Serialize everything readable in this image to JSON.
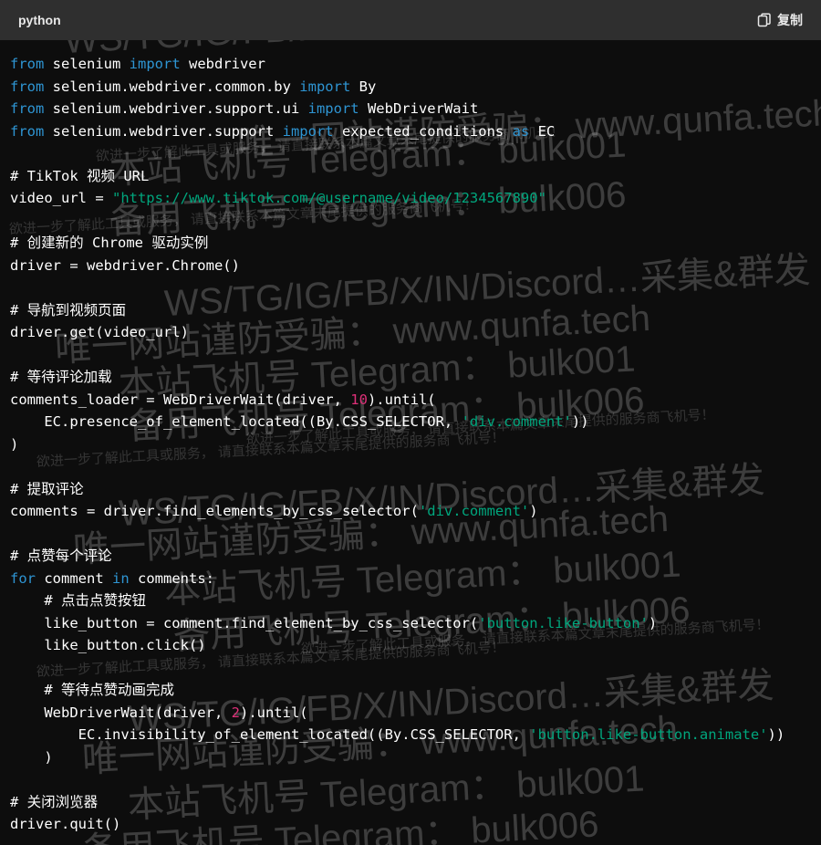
{
  "header": {
    "language": "python",
    "copy_label": "复制",
    "copy_icon": "copy-icon"
  },
  "colors": {
    "background": "#0d0d0d",
    "header_bg": "#2f2f2f",
    "keyword": "#2e95d3",
    "string": "#00a67d",
    "number": "#df3079",
    "text": "#ffffff"
  },
  "code": [
    {
      "kind": "code",
      "tokens": [
        {
          "t": "kw",
          "v": "from"
        },
        {
          "t": "p",
          "v": " selenium "
        },
        {
          "t": "kw",
          "v": "import"
        },
        {
          "t": "p",
          "v": " webdriver"
        }
      ]
    },
    {
      "kind": "code",
      "tokens": [
        {
          "t": "kw",
          "v": "from"
        },
        {
          "t": "p",
          "v": " selenium.webdriver.common.by "
        },
        {
          "t": "kw",
          "v": "import"
        },
        {
          "t": "p",
          "v": " By"
        }
      ]
    },
    {
      "kind": "code",
      "tokens": [
        {
          "t": "kw",
          "v": "from"
        },
        {
          "t": "p",
          "v": " selenium.webdriver.support.ui "
        },
        {
          "t": "kw",
          "v": "import"
        },
        {
          "t": "p",
          "v": " WebDriverWait"
        }
      ]
    },
    {
      "kind": "code",
      "tokens": [
        {
          "t": "kw",
          "v": "from"
        },
        {
          "t": "p",
          "v": " selenium.webdriver.support "
        },
        {
          "t": "kw",
          "v": "import"
        },
        {
          "t": "p",
          "v": " expected_conditions "
        },
        {
          "t": "kw",
          "v": "as"
        },
        {
          "t": "p",
          "v": " EC"
        }
      ]
    },
    {
      "kind": "blank",
      "tokens": []
    },
    {
      "kind": "comment",
      "tokens": [
        {
          "t": "cm",
          "v": "# TikTok 视频 URL"
        }
      ]
    },
    {
      "kind": "code",
      "tokens": [
        {
          "t": "p",
          "v": "video_url = "
        },
        {
          "t": "str",
          "v": "\"https://www.tiktok.com/@username/video/1234567890\""
        }
      ]
    },
    {
      "kind": "blank",
      "tokens": []
    },
    {
      "kind": "comment",
      "tokens": [
        {
          "t": "cm",
          "v": "# 创建新的 Chrome 驱动实例"
        }
      ]
    },
    {
      "kind": "code",
      "tokens": [
        {
          "t": "p",
          "v": "driver = webdriver.Chrome()"
        }
      ]
    },
    {
      "kind": "blank",
      "tokens": []
    },
    {
      "kind": "comment",
      "tokens": [
        {
          "t": "cm",
          "v": "# 导航到视频页面"
        }
      ]
    },
    {
      "kind": "code",
      "tokens": [
        {
          "t": "p",
          "v": "driver.get(video_url)"
        }
      ]
    },
    {
      "kind": "blank",
      "tokens": []
    },
    {
      "kind": "comment",
      "tokens": [
        {
          "t": "cm",
          "v": "# 等待评论加载"
        }
      ]
    },
    {
      "kind": "code",
      "tokens": [
        {
          "t": "p",
          "v": "comments_loader = WebDriverWait(driver, "
        },
        {
          "t": "num",
          "v": "10"
        },
        {
          "t": "p",
          "v": ").until("
        }
      ]
    },
    {
      "kind": "code",
      "tokens": [
        {
          "t": "p",
          "v": "    EC.presence_of_element_located((By.CSS_SELECTOR, "
        },
        {
          "t": "str",
          "v": "'div.comment'"
        },
        {
          "t": "p",
          "v": "))"
        }
      ]
    },
    {
      "kind": "code",
      "tokens": [
        {
          "t": "p",
          "v": ")"
        }
      ]
    },
    {
      "kind": "blank",
      "tokens": []
    },
    {
      "kind": "comment",
      "tokens": [
        {
          "t": "cm",
          "v": "# 提取评论"
        }
      ]
    },
    {
      "kind": "code",
      "tokens": [
        {
          "t": "p",
          "v": "comments = driver.find_elements_by_css_selector("
        },
        {
          "t": "str",
          "v": "'div.comment'"
        },
        {
          "t": "p",
          "v": ")"
        }
      ]
    },
    {
      "kind": "blank",
      "tokens": []
    },
    {
      "kind": "comment",
      "tokens": [
        {
          "t": "cm",
          "v": "# 点赞每个评论"
        }
      ]
    },
    {
      "kind": "code",
      "tokens": [
        {
          "t": "kw",
          "v": "for"
        },
        {
          "t": "p",
          "v": " comment "
        },
        {
          "t": "kw",
          "v": "in"
        },
        {
          "t": "p",
          "v": " comments:"
        }
      ]
    },
    {
      "kind": "comment",
      "tokens": [
        {
          "t": "cm",
          "v": "    # 点击点赞按钮"
        }
      ]
    },
    {
      "kind": "code",
      "tokens": [
        {
          "t": "p",
          "v": "    like_button = comment.find_element_by_css_selector("
        },
        {
          "t": "str",
          "v": "'button.like-button'"
        },
        {
          "t": "p",
          "v": ")"
        }
      ]
    },
    {
      "kind": "code",
      "tokens": [
        {
          "t": "p",
          "v": "    like_button.click()"
        }
      ]
    },
    {
      "kind": "blank",
      "tokens": []
    },
    {
      "kind": "comment",
      "tokens": [
        {
          "t": "cm",
          "v": "    # 等待点赞动画完成"
        }
      ]
    },
    {
      "kind": "code",
      "tokens": [
        {
          "t": "p",
          "v": "    WebDriverWait(driver, "
        },
        {
          "t": "num",
          "v": "2"
        },
        {
          "t": "p",
          "v": ").until("
        }
      ]
    },
    {
      "kind": "code",
      "tokens": [
        {
          "t": "p",
          "v": "        EC.invisibility_of_element_located((By.CSS_SELECTOR, "
        },
        {
          "t": "str",
          "v": "'button.like-button.animate'"
        },
        {
          "t": "p",
          "v": "))"
        }
      ]
    },
    {
      "kind": "code",
      "tokens": [
        {
          "t": "p",
          "v": "    )"
        }
      ]
    },
    {
      "kind": "blank",
      "tokens": []
    },
    {
      "kind": "comment",
      "tokens": [
        {
          "t": "cm",
          "v": "# 关闭浏览器"
        }
      ]
    },
    {
      "kind": "code",
      "tokens": [
        {
          "t": "p",
          "v": "driver.quit()"
        }
      ]
    }
  ],
  "watermark": {
    "lines": [
      {
        "text": "WS/TG/IG/FB/X/IN/Discord…采集&群发",
        "size": "big"
      },
      {
        "text": "唯一网站谨防受骗： www.qunfa.tech",
        "size": "big"
      },
      {
        "text": "本站飞机号 Telegram： bulk001",
        "size": "big"
      },
      {
        "text": "备用飞机号 Telegram： bulk006",
        "size": "big"
      },
      {
        "text": "欲进一步了解此工具或服务， 请直接联系本篇文章末尾提供的服务商飞机号！",
        "size": "small"
      }
    ]
  }
}
